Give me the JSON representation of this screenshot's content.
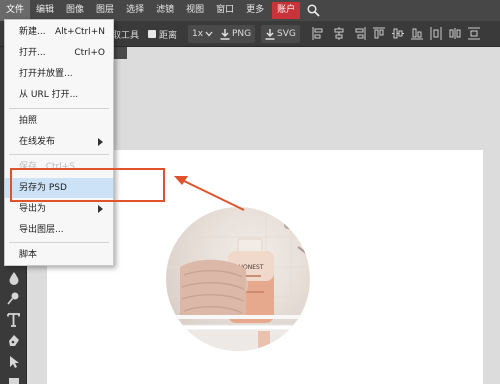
{
  "menubar": {
    "items": [
      "文件",
      "编辑",
      "图像",
      "图层",
      "选择",
      "滤镜",
      "视图",
      "窗口",
      "更多"
    ],
    "account": "账户"
  },
  "options": {
    "partial_label": "取工具",
    "distance_label": "距离",
    "zoom": "1x",
    "png": "PNG",
    "svg": "SVG"
  },
  "file_menu": {
    "items": [
      {
        "label": "新建...",
        "shortcut": "Alt+Ctrl+N"
      },
      {
        "label": "打开...",
        "shortcut": "Ctrl+O"
      },
      {
        "label": "打开并放置..."
      },
      {
        "label": "从 URL 打开..."
      },
      {
        "label": "拍照"
      },
      {
        "label": "在线发布"
      },
      {
        "label": "保存",
        "shortcut": "Ctrl+S"
      },
      {
        "label": "另存为 PSD"
      },
      {
        "label": "导出为"
      },
      {
        "label": "导出图层..."
      },
      {
        "label": "脚本"
      }
    ]
  },
  "product": {
    "brand": "HONEST"
  },
  "colors": {
    "accent": "#c9333a",
    "highlight": "#cce2f6",
    "callout": "#e2522a"
  }
}
